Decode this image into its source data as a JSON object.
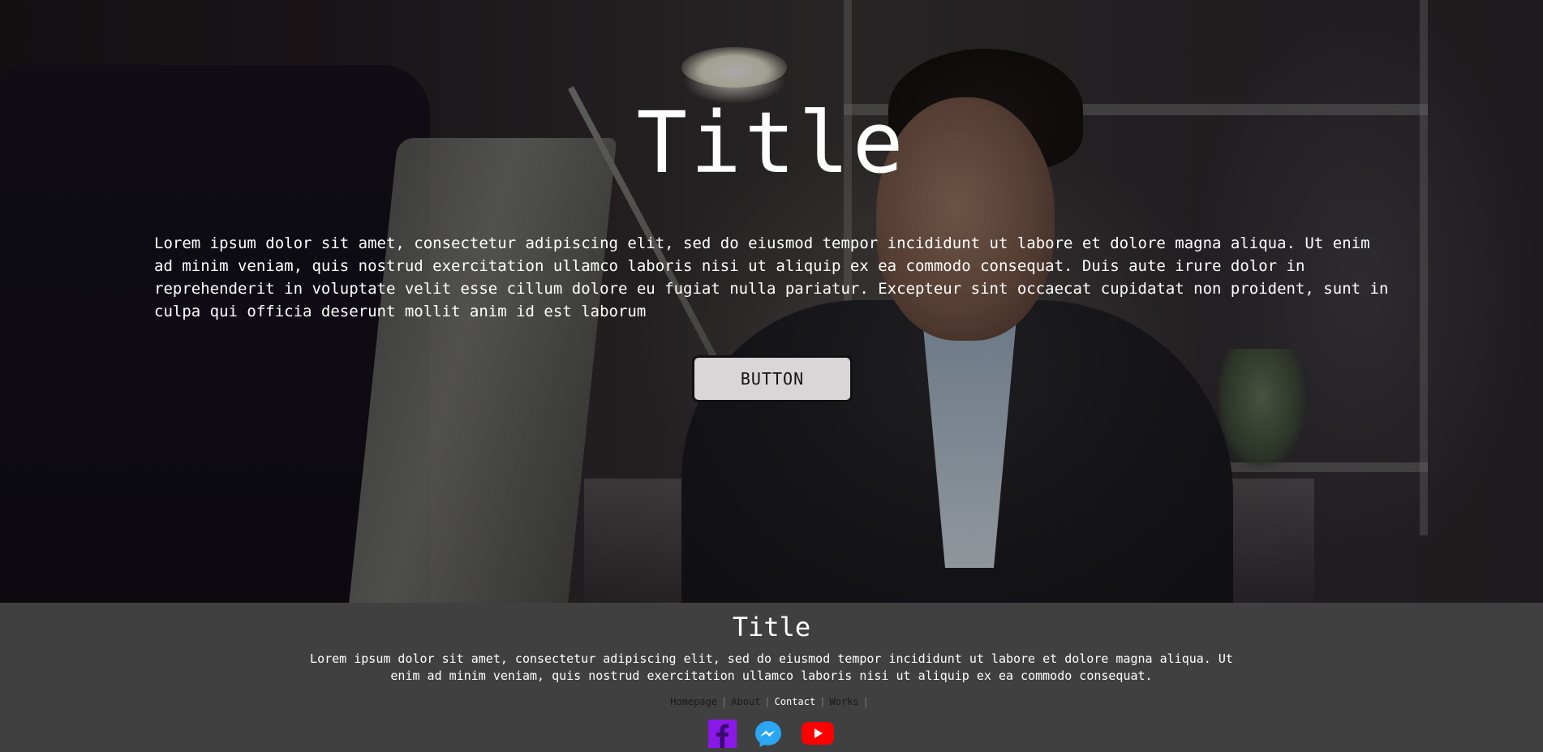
{
  "hero": {
    "title": "Title",
    "text": "Lorem ipsum dolor sit amet, consectetur adipiscing elit, sed do eiusmod tempor incididunt ut labore et dolore magna aliqua. Ut enim ad minim veniam, quis nostrud exercitation ullamco laboris nisi ut aliquip ex ea commodo consequat. Duis aute irure dolor in reprehenderit in voluptate velit esse cillum dolore eu fugiat nulla pariatur. Excepteur sint occaecat cupidatat non proident, sunt in culpa qui officia deserunt mollit anim id est laborum",
    "button_label": "BUTTON"
  },
  "footer": {
    "title": "Title",
    "text": "Lorem ipsum dolor sit amet, consectetur adipiscing elit, sed do eiusmod tempor incididunt ut labore et dolore magna aliqua. Ut enim ad minim veniam, quis nostrud exercitation ullamco laboris nisi ut aliquip ex ea commodo consequat.",
    "nav": [
      {
        "label": "Homepage"
      },
      {
        "label": "About"
      },
      {
        "label": "Contact"
      },
      {
        "label": "Works"
      }
    ],
    "separator": "|",
    "active_nav": "Contact",
    "social": [
      {
        "icon": "facebook-icon",
        "color": "#8a18e8"
      },
      {
        "icon": "messenger-icon",
        "color": "#2aa6f5"
      },
      {
        "icon": "youtube-icon",
        "color": "#ff0000"
      }
    ]
  },
  "colors": {
    "footer_bg": "#404040",
    "button_bg": "#d8d6d6",
    "text": "#ffffff"
  }
}
